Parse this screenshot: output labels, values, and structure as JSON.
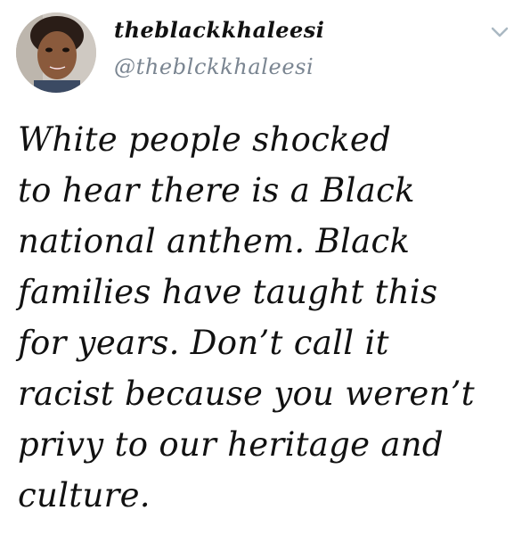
{
  "tweet": {
    "display_name": "theblackkhaleesi",
    "handle": "@theblckkhaleesi",
    "lines": [
      "White people shocked",
      "to hear there is a Black",
      "national anthem. Black",
      "families have taught this",
      "for years. Don’t call it",
      "racist because you weren’t",
      "privy to our heritage and",
      "culture."
    ]
  },
  "icons": {
    "avatar": "profile-photo",
    "chevron": "chevron-down-icon"
  },
  "colors": {
    "text": "#111111",
    "handle": "#7a8591",
    "chevron": "#aab8c2",
    "background": "#ffffff"
  }
}
